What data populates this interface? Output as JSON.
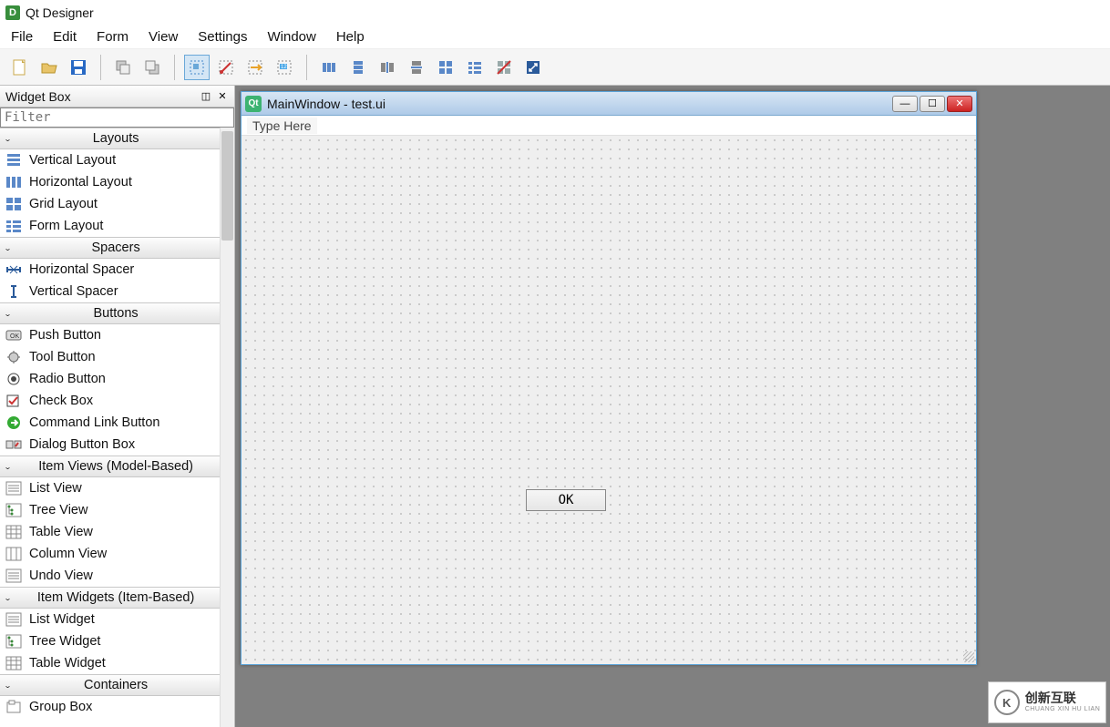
{
  "app": {
    "title": "Qt Designer"
  },
  "menu": [
    "File",
    "Edit",
    "Form",
    "View",
    "Settings",
    "Window",
    "Help"
  ],
  "widget_box": {
    "title": "Widget Box",
    "filter_placeholder": "Filter",
    "categories": [
      {
        "name": "Layouts",
        "items": [
          {
            "icon": "vlayout",
            "label": "Vertical Layout"
          },
          {
            "icon": "hlayout",
            "label": "Horizontal Layout"
          },
          {
            "icon": "grid",
            "label": "Grid Layout"
          },
          {
            "icon": "form",
            "label": "Form Layout"
          }
        ]
      },
      {
        "name": "Spacers",
        "items": [
          {
            "icon": "hspacer",
            "label": "Horizontal Spacer"
          },
          {
            "icon": "vspacer",
            "label": "Vertical Spacer"
          }
        ]
      },
      {
        "name": "Buttons",
        "items": [
          {
            "icon": "pushbtn",
            "label": "Push Button"
          },
          {
            "icon": "toolbtn",
            "label": "Tool Button"
          },
          {
            "icon": "radio",
            "label": "Radio Button"
          },
          {
            "icon": "check",
            "label": "Check Box"
          },
          {
            "icon": "cmdlink",
            "label": "Command Link Button"
          },
          {
            "icon": "dlgbtn",
            "label": "Dialog Button Box"
          }
        ]
      },
      {
        "name": "Item Views (Model-Based)",
        "items": [
          {
            "icon": "list",
            "label": "List View"
          },
          {
            "icon": "tree",
            "label": "Tree View"
          },
          {
            "icon": "table",
            "label": "Table View"
          },
          {
            "icon": "column",
            "label": "Column View"
          },
          {
            "icon": "undo",
            "label": "Undo View"
          }
        ]
      },
      {
        "name": "Item Widgets (Item-Based)",
        "items": [
          {
            "icon": "list",
            "label": "List Widget"
          },
          {
            "icon": "tree",
            "label": "Tree Widget"
          },
          {
            "icon": "table",
            "label": "Table Widget"
          }
        ]
      },
      {
        "name": "Containers",
        "items": [
          {
            "icon": "group",
            "label": "Group Box"
          }
        ]
      }
    ]
  },
  "design_window": {
    "title": "MainWindow - test.ui",
    "menu_hint": "Type Here",
    "ok_button": "OK"
  },
  "watermark": {
    "text": "创新互联",
    "sub": "CHUANG XIN HU LIAN"
  }
}
